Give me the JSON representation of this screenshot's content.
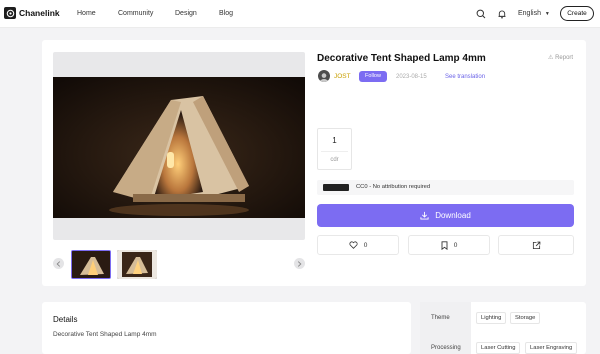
{
  "header": {
    "logo_text": "Chanelink",
    "nav": [
      "Home",
      "Community",
      "Design",
      "Blog"
    ],
    "language": "English",
    "create_label": "Create"
  },
  "product": {
    "title": "Decorative Tent Shaped Lamp 4mm",
    "report_label": "Report",
    "author": "JOST",
    "follow_label": "Follow",
    "date": "2023-08-15",
    "translate_label": "See translation",
    "file": {
      "count": "1",
      "ext": "cdr"
    },
    "license": "CC0 - No attribution required",
    "download_label": "Download",
    "likes": "0",
    "saves": "0"
  },
  "details": {
    "title": "Details",
    "text": "Decorative Tent Shaped Lamp 4mm"
  },
  "tags": {
    "theme_label": "Theme",
    "theme_values": [
      "Lighting",
      "Storage"
    ],
    "processing_label": "Processing",
    "processing_values": [
      "Laser Cutting",
      "Laser Engraving"
    ]
  },
  "colors": {
    "accent": "#7c6cf2",
    "author": "#c9a000"
  }
}
